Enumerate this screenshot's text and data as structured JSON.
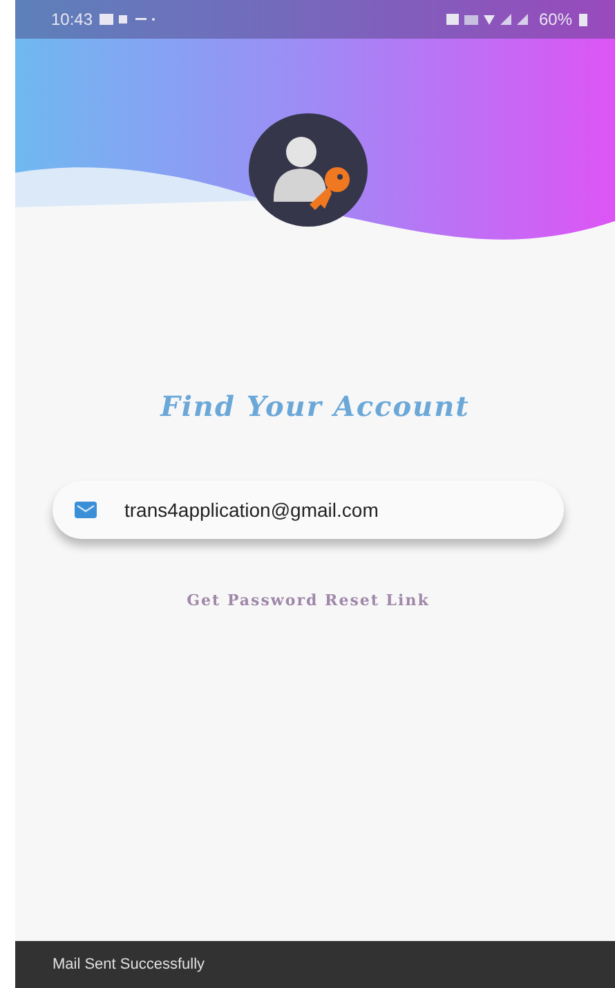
{
  "status_bar": {
    "time": "10:43",
    "battery": "60%"
  },
  "title": "Find Your Account",
  "email_field": {
    "value": "trans4application@gmail.com"
  },
  "reset_link": "Get Password Reset Link",
  "snackbar": {
    "message": "Mail Sent Successfully"
  }
}
